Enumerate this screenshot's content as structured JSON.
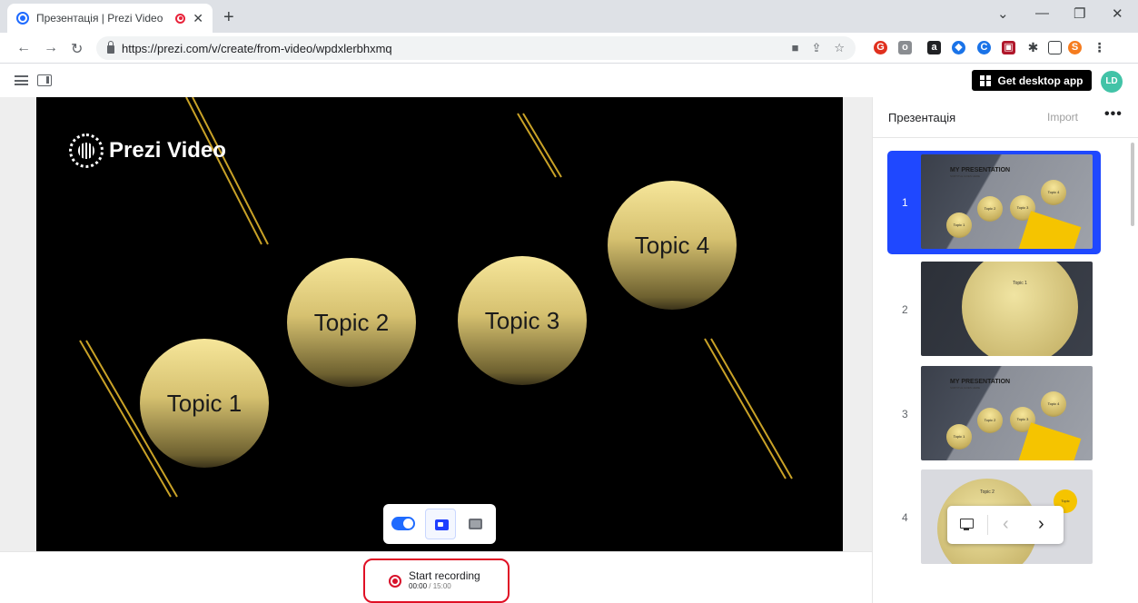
{
  "browser": {
    "tab_title": "Презентація | Prezi Video",
    "tab_close": "✕",
    "new_tab": "+",
    "url": "https://prezi.com/v/create/from-video/wpdxlerbhxmq",
    "window_controls": [
      "⌄",
      "—",
      "❐",
      "✕"
    ]
  },
  "toolbar": {
    "get_app_label": "Get desktop app",
    "avatar_initials": "LD"
  },
  "stage": {
    "brand": "Prezi Video",
    "topics": [
      "Topic 1",
      "Topic 2",
      "Topic 3",
      "Topic 4"
    ]
  },
  "recording": {
    "label": "Start recording",
    "elapsed": "00:00",
    "limit": "/ 15:00"
  },
  "sidebar": {
    "title": "Презентація",
    "import_label": "Import",
    "more": "•••",
    "slides": [
      {
        "number": "1",
        "selected": true
      },
      {
        "number": "2",
        "selected": false
      },
      {
        "number": "3",
        "selected": false
      },
      {
        "number": "4",
        "selected": false
      }
    ],
    "thumb_text": {
      "heading": "MY PRESENTATION",
      "subheading": "SUBTITLE GOES HERE",
      "topic1": "Topic 1",
      "topic2": "Topic 2",
      "topic3": "Topic 3",
      "topic4": "Topic 4",
      "topic_short": "Topic"
    }
  },
  "slide_nav": {
    "prev": "‹",
    "next": "›"
  },
  "colors": {
    "accent": "#1f48ff",
    "record": "#e01025",
    "gold": "#f5c400"
  }
}
